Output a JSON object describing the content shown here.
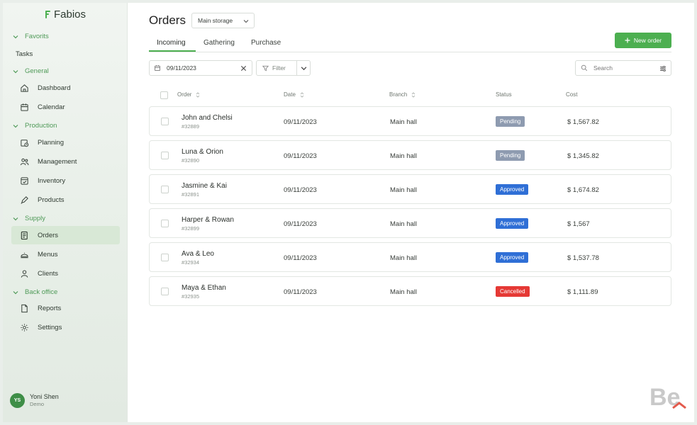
{
  "app": {
    "name": "Fabios"
  },
  "sidebar": {
    "sections": [
      {
        "label": "Favorits"
      },
      {
        "label": "General"
      },
      {
        "label": "Production"
      },
      {
        "label": "Supply"
      },
      {
        "label": "Back office"
      }
    ],
    "tasks_label": "Tasks",
    "items": [
      {
        "label": "Dashboard",
        "icon": "home-icon"
      },
      {
        "label": "Calendar",
        "icon": "calendar-icon"
      },
      {
        "label": "Planning",
        "icon": "planning-icon"
      },
      {
        "label": "Management",
        "icon": "people-icon"
      },
      {
        "label": "Inventory",
        "icon": "inventory-icon"
      },
      {
        "label": "Products",
        "icon": "pen-icon"
      },
      {
        "label": "Orders",
        "icon": "document-icon"
      },
      {
        "label": "Menus",
        "icon": "cloche-icon"
      },
      {
        "label": "Clients",
        "icon": "user-icon"
      },
      {
        "label": "Reports",
        "icon": "file-icon"
      },
      {
        "label": "Settings",
        "icon": "gear-icon"
      }
    ],
    "active_item": "Orders",
    "user": {
      "initials": "YS",
      "name": "Yoni Shen",
      "role": "Demo"
    }
  },
  "header": {
    "title": "Orders",
    "storage_select": "Main storage",
    "new_order_label": "New order"
  },
  "tabs": [
    {
      "label": "Incoming",
      "active": true
    },
    {
      "label": "Gathering",
      "active": false
    },
    {
      "label": "Purchase",
      "active": false
    }
  ],
  "filters": {
    "date_value": "09/11/2023",
    "filter_label": "Filter",
    "search_placeholder": "Search"
  },
  "table": {
    "columns": [
      "Order",
      "Date",
      "Branch",
      "Status",
      "Cost"
    ],
    "rows": [
      {
        "name": "John and Chelsi",
        "id": "#32889",
        "date": "09/11/2023",
        "branch": "Main hall",
        "status": "Pending",
        "cost": "$ 1,567.82"
      },
      {
        "name": "Luna & Orion",
        "id": "#32890",
        "date": "09/11/2023",
        "branch": "Main hall",
        "status": "Pending",
        "cost": "$ 1,345.82"
      },
      {
        "name": "Jasmine & Kai",
        "id": "#32891",
        "date": "09/11/2023",
        "branch": "Main hall",
        "status": "Approved",
        "cost": "$ 1,674.82"
      },
      {
        "name": "Harper & Rowan",
        "id": "#32899",
        "date": "09/11/2023",
        "branch": "Main hall",
        "status": "Approved",
        "cost": "$ 1,567"
      },
      {
        "name": "Ava & Leo",
        "id": "#32934",
        "date": "09/11/2023",
        "branch": "Main hall",
        "status": "Approved",
        "cost": "$ 1,537.78"
      },
      {
        "name": "Maya & Ethan",
        "id": "#32935",
        "date": "09/11/2023",
        "branch": "Main hall",
        "status": "Cancelled",
        "cost": "$ 1,111.89"
      }
    ]
  },
  "colors": {
    "accent": "#4caf50",
    "pending": "#8e9bb0",
    "approved": "#2f6fd6",
    "cancelled": "#e53935"
  },
  "watermark": {
    "text": "Be"
  }
}
